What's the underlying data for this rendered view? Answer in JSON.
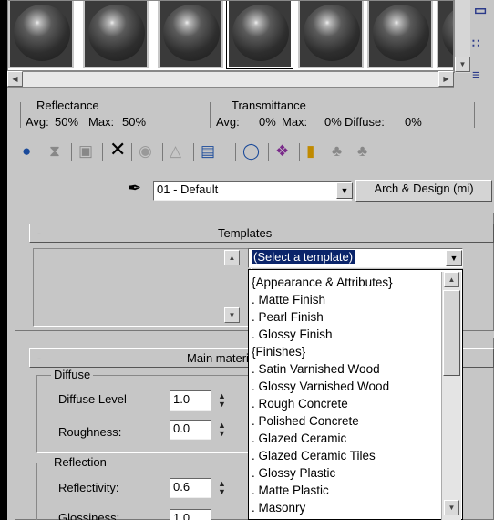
{
  "reflectance": {
    "title": "Reflectance",
    "avg_label": "Avg:",
    "avg": "50%",
    "max_label": "Max:",
    "max": "50%"
  },
  "transmittance": {
    "title": "Transmittance",
    "avg_label": "Avg:",
    "avg": "0%",
    "max_label": "Max:",
    "max": "0%",
    "diffuse_label": "Diffuse:",
    "diffuse": "0%"
  },
  "material": {
    "name": "01 - Default",
    "type": "Arch & Design (mi)"
  },
  "templates": {
    "collapse": "-",
    "title": "Templates",
    "select_value": "(Select a template)",
    "options": [
      "{Appearance & Attributes}",
      ". Matte Finish",
      ". Pearl Finish",
      ". Glossy Finish",
      "{Finishes}",
      ". Satin Varnished Wood",
      ". Glossy Varnished Wood",
      ". Rough Concrete",
      ". Polished Concrete",
      ". Glazed Ceramic",
      ". Glazed Ceramic Tiles",
      ". Glossy Plastic",
      ". Matte Plastic",
      ". Masonry"
    ]
  },
  "main": {
    "collapse": "-",
    "title": "Main materi",
    "diffuse": {
      "group": "Diffuse",
      "level_label": "Diffuse Level",
      "level": "1.0",
      "roughness_label": "Roughness:",
      "roughness": "0.0"
    },
    "reflection": {
      "group": "Reflection",
      "reflectivity_label": "Reflectivity:",
      "reflectivity": "0.6",
      "glossiness_label": "Glossiness:",
      "glossiness": "1.0"
    }
  },
  "icons": {
    "toolbar": [
      "get-material-icon",
      "put-to-scene-icon",
      "assign-icon",
      "reset-icon",
      "make-copy-icon",
      "make-unique-icon",
      "put-to-library-icon",
      "material-id-icon",
      "show-map-icon",
      "show-end-result-icon",
      "go-parent-icon",
      "go-sibling-icon"
    ]
  },
  "colors": {
    "panel": "#c6c6c6",
    "select_highlight": "#0a246a"
  }
}
